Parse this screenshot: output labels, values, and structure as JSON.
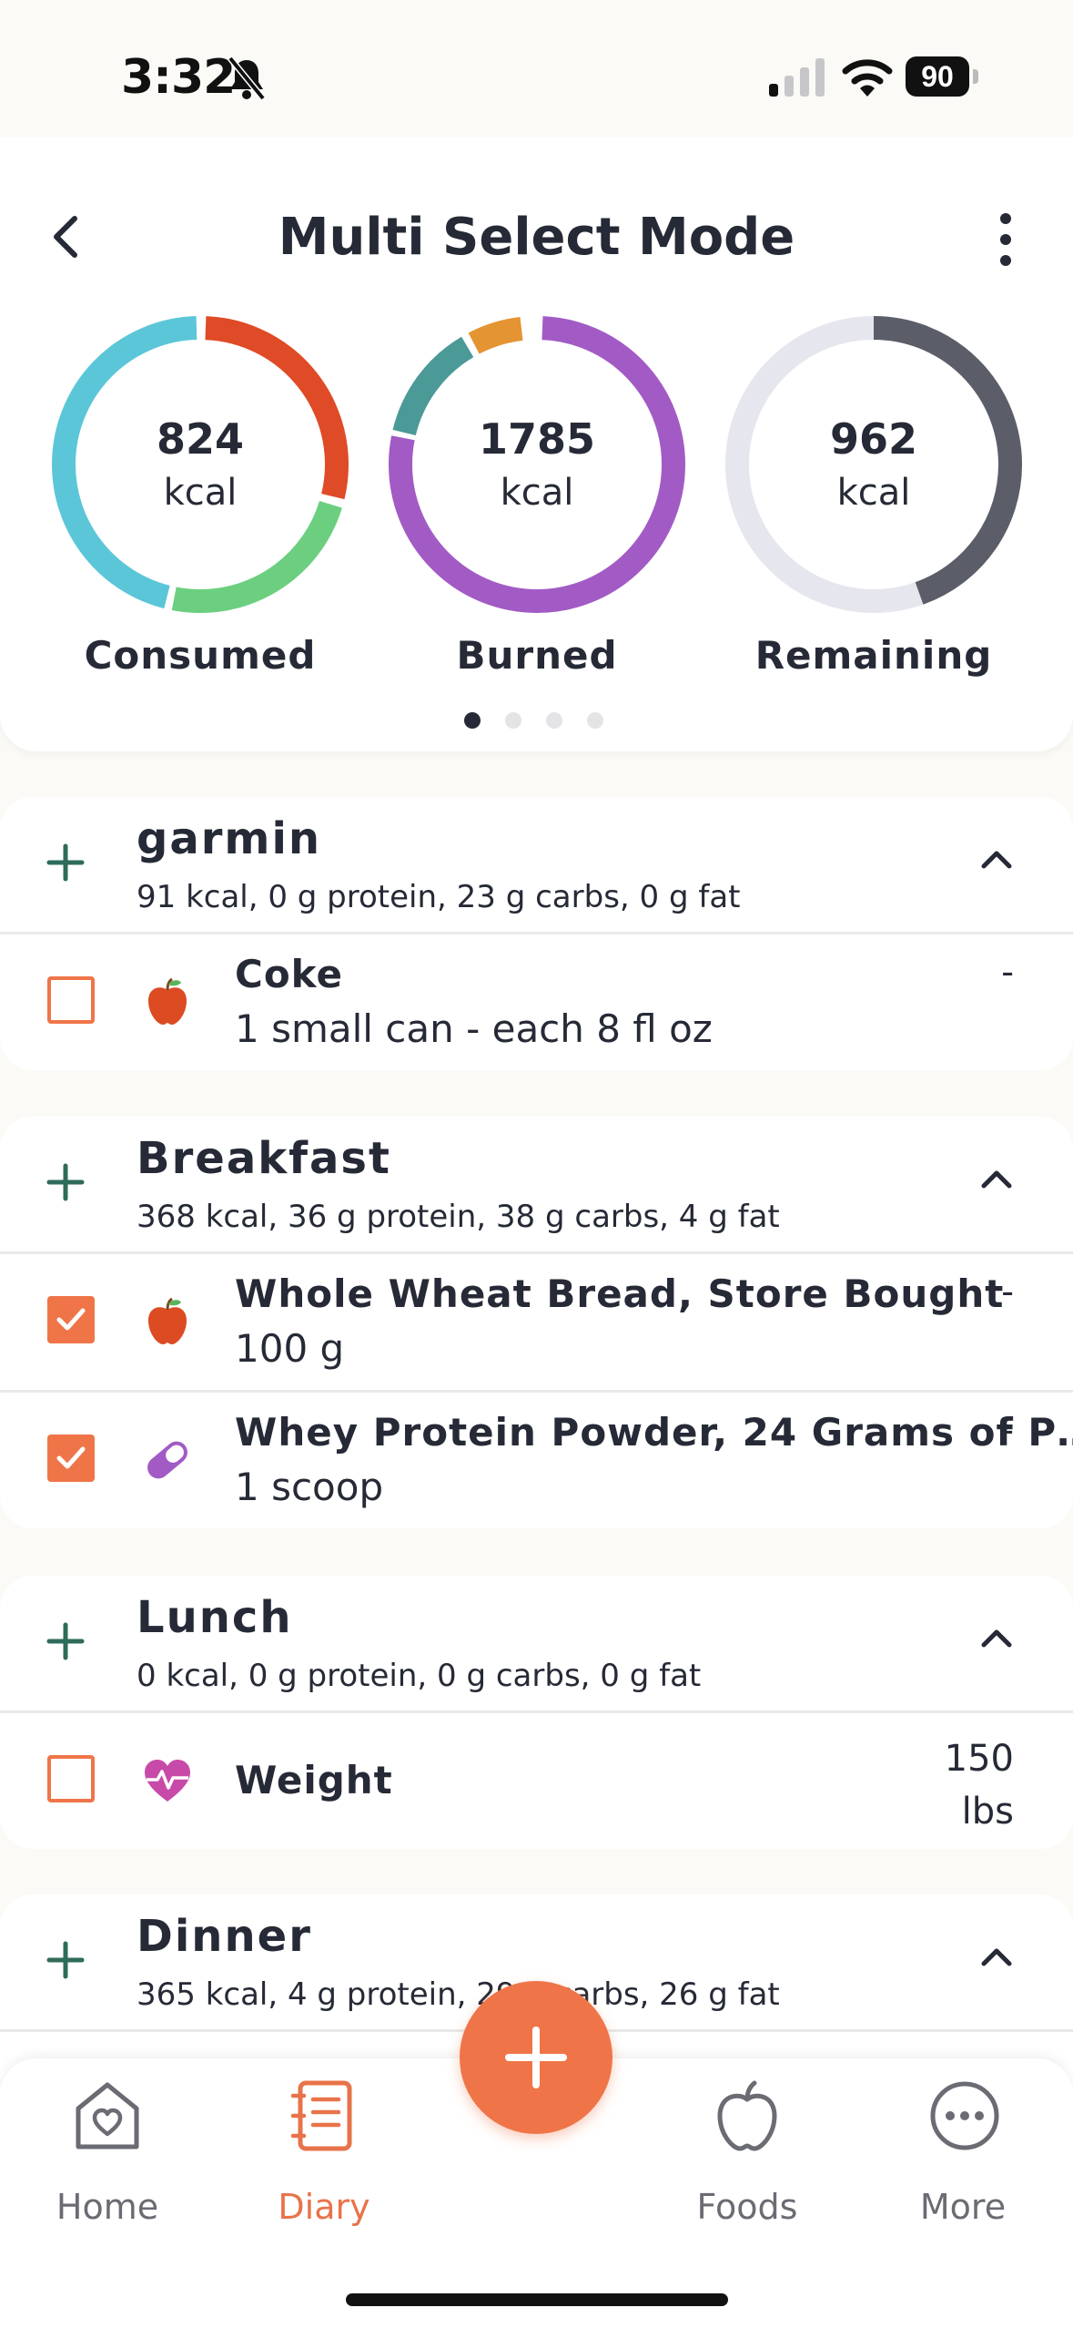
{
  "status_bar": {
    "time": "3:32",
    "battery": "90"
  },
  "header": {
    "title": "Multi Select Mode"
  },
  "summary": [
    {
      "value": "824",
      "unit": "kcal",
      "label": "Consumed"
    },
    {
      "value": "1785",
      "unit": "kcal",
      "label": "Burned"
    },
    {
      "value": "962",
      "unit": "kcal",
      "label": "Remaining"
    }
  ],
  "carousel": {
    "active_page": 1,
    "page_count": 4
  },
  "meals": [
    {
      "name": "garmin",
      "summary": "91 kcal, 0 g protein, 23 g carbs, 0 g fat",
      "items": [
        {
          "name": "Coke",
          "serving": "1 small can - each 8 fl oz",
          "value": "-",
          "checked": false,
          "icon": "apple-icon"
        }
      ]
    },
    {
      "name": "Breakfast",
      "summary": "368 kcal, 36 g protein, 38 g carbs, 4 g fat",
      "items": [
        {
          "name": "Whole Wheat Bread, Store Bought",
          "serving": "100 g",
          "value": "-",
          "checked": true,
          "icon": "apple-icon"
        },
        {
          "name": "Whey Protein Powder, 24 Grams of P…",
          "serving": "1 scoop",
          "value": "-",
          "checked": true,
          "icon": "pill-icon"
        }
      ]
    },
    {
      "name": "Lunch",
      "summary": "0 kcal, 0 g protein, 0 g carbs, 0 g fat",
      "items": [
        {
          "name": "Weight",
          "value_line1": "150",
          "value_line2": "lbs",
          "checked": false,
          "icon": "heart-pulse-icon"
        }
      ]
    },
    {
      "name": "Dinner",
      "summary": "365 kcal, 4 g protein, 29 g carbs, 26 g fat",
      "items": []
    }
  ],
  "tabs": [
    {
      "label": "Home",
      "icon": "home-heart-icon",
      "active": false
    },
    {
      "label": "Diary",
      "icon": "notebook-icon",
      "active": true
    },
    {
      "label": "Foods",
      "icon": "apple-outline-icon",
      "active": false
    },
    {
      "label": "More",
      "icon": "more-dots-icon",
      "active": false
    }
  ],
  "colors": {
    "accent": "#ef7548",
    "consumed_ring": [
      "#5bc6d8",
      "#df4b26",
      "#6bcf7f"
    ],
    "burned_ring": [
      "#a25bc4",
      "#4b9a97",
      "#e49432"
    ],
    "remaining_ring": [
      "#5b5d69",
      "#e6e6ee"
    ],
    "plus_icon": "#2f6b5a"
  }
}
